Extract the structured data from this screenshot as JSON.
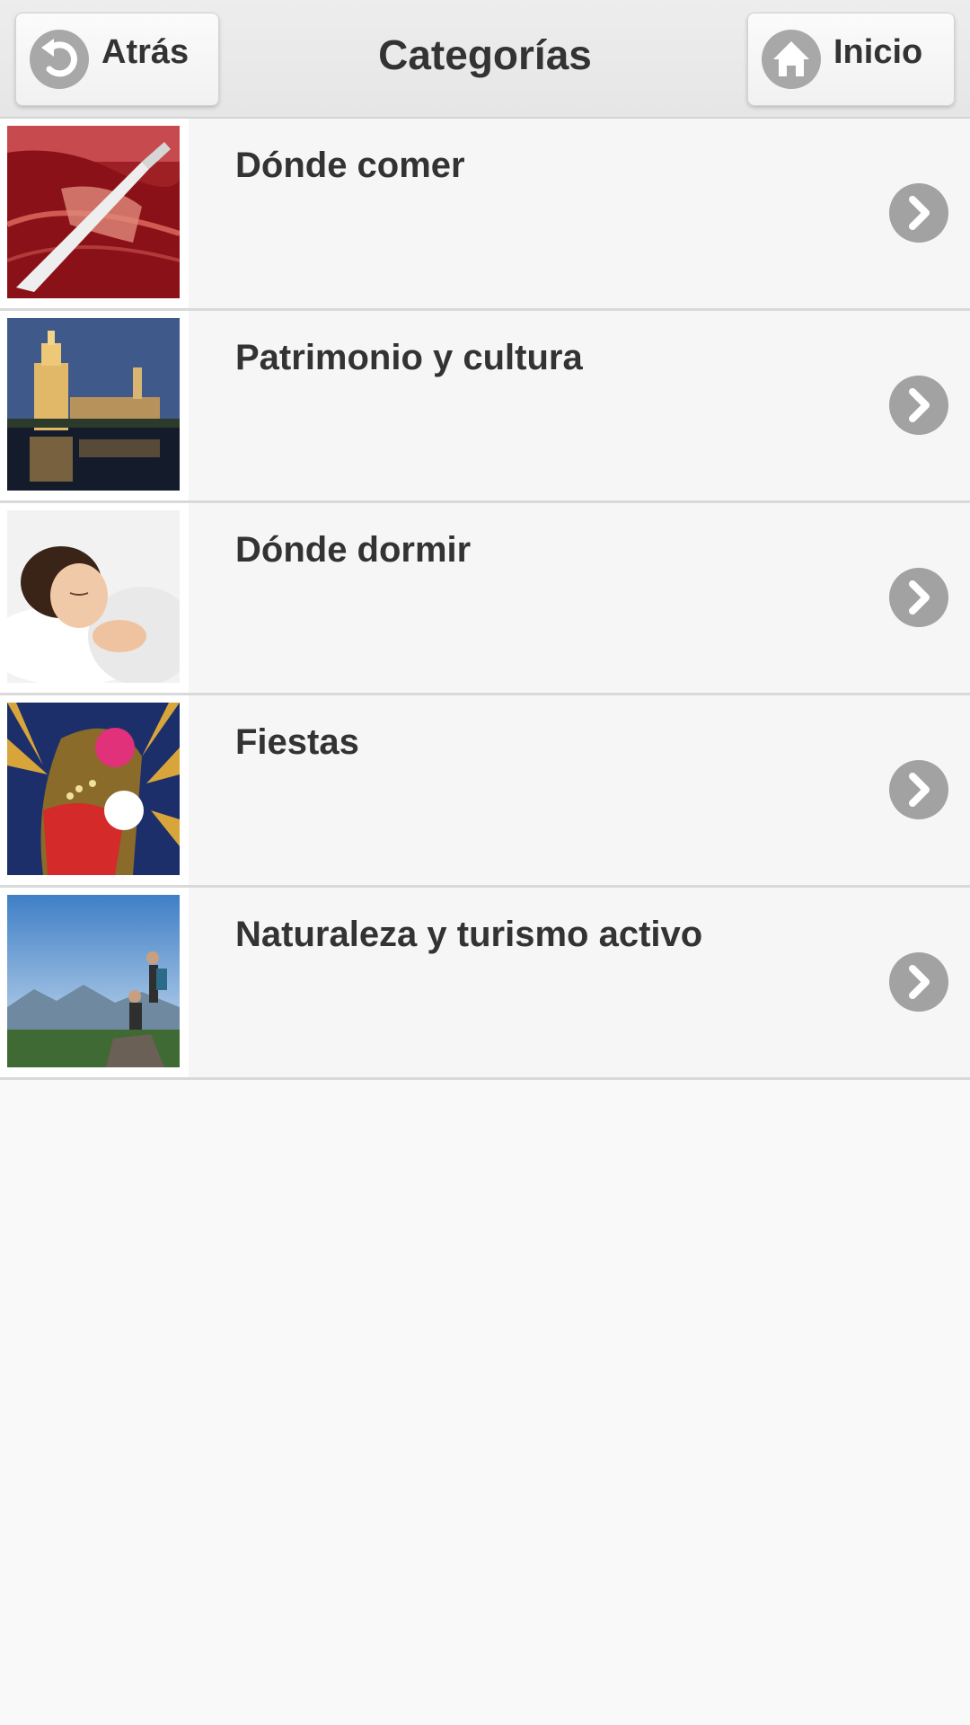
{
  "header": {
    "back_label": "Atrás",
    "title": "Categorías",
    "home_label": "Inicio",
    "back_icon": "back-arrow-icon",
    "home_icon": "home-icon"
  },
  "categories": [
    {
      "label": "Dónde comer",
      "image": "jamon-photo"
    },
    {
      "label": "Patrimonio y cultura",
      "image": "torre-del-oro-photo"
    },
    {
      "label": "Dónde dormir",
      "image": "sleeping-woman-photo"
    },
    {
      "label": "Fiestas",
      "image": "feria-poster-illustration"
    },
    {
      "label": "Naturaleza y turismo activo",
      "image": "hikers-mountain-photo"
    }
  ],
  "colors": {
    "header_bg": "#e9e9e9",
    "item_bg": "#f6f6f6",
    "text": "#333333",
    "icon_circle": "#a8a8a8"
  }
}
